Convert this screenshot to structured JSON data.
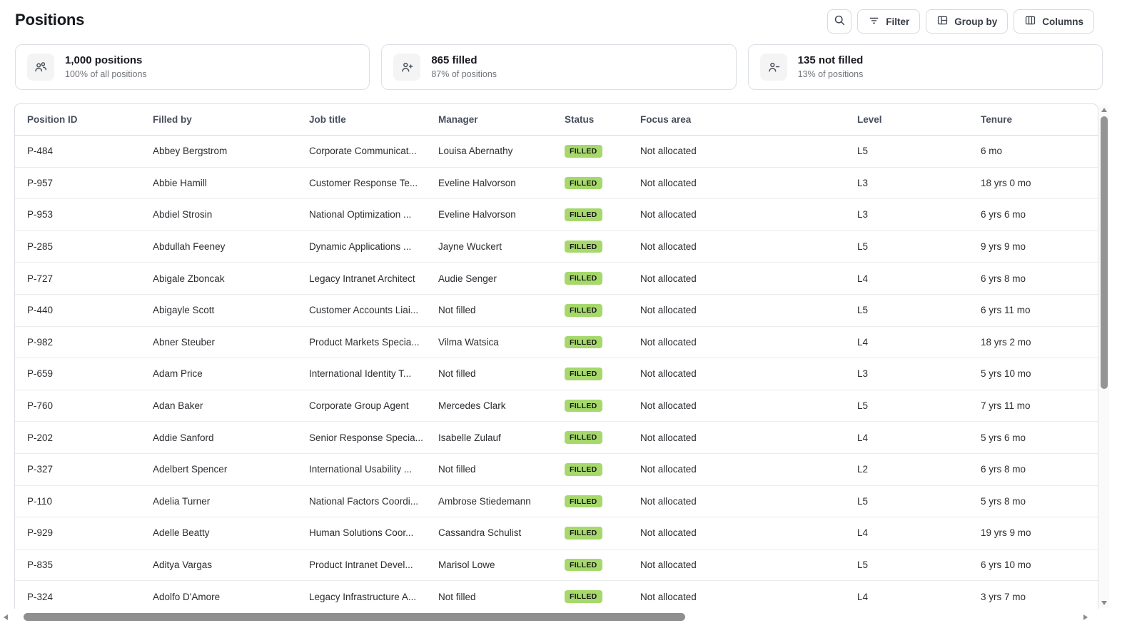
{
  "page": {
    "title": "Positions"
  },
  "toolbar": {
    "search_icon": "search-icon",
    "filter": {
      "label": "Filter",
      "icon": "filter-lines-icon"
    },
    "group_by": {
      "label": "Group by",
      "icon": "table-grid-icon"
    },
    "columns": {
      "label": "Columns",
      "icon": "columns-icon"
    }
  },
  "stats": [
    {
      "icon": "people-icon",
      "title": "1,000 positions",
      "subtitle": "100% of all positions"
    },
    {
      "icon": "person-plus-icon",
      "title": "865 filled",
      "subtitle": "87% of positions"
    },
    {
      "icon": "person-minus-icon",
      "title": "135 not filled",
      "subtitle": "13% of positions"
    }
  ],
  "table": {
    "columns": [
      "Position ID",
      "Filled by",
      "Job title",
      "Manager",
      "Status",
      "Focus area",
      "Level",
      "Tenure"
    ],
    "row_keys": [
      "position_id",
      "filled_by",
      "job_title",
      "manager",
      "status",
      "focus_area",
      "level",
      "tenure"
    ],
    "rows": [
      {
        "position_id": "P-484",
        "filled_by": "Abbey Bergstrom",
        "job_title": "Corporate Communicat...",
        "manager": "Louisa Abernathy",
        "status": "FILLED",
        "focus_area": "Not allocated",
        "level": "L5",
        "tenure": "6 mo"
      },
      {
        "position_id": "P-957",
        "filled_by": "Abbie Hamill",
        "job_title": "Customer Response Te...",
        "manager": "Eveline Halvorson",
        "status": "FILLED",
        "focus_area": "Not allocated",
        "level": "L3",
        "tenure": "18 yrs 0 mo"
      },
      {
        "position_id": "P-953",
        "filled_by": "Abdiel Strosin",
        "job_title": "National Optimization ...",
        "manager": "Eveline Halvorson",
        "status": "FILLED",
        "focus_area": "Not allocated",
        "level": "L3",
        "tenure": "6 yrs 6 mo"
      },
      {
        "position_id": "P-285",
        "filled_by": "Abdullah Feeney",
        "job_title": "Dynamic Applications ...",
        "manager": "Jayne Wuckert",
        "status": "FILLED",
        "focus_area": "Not allocated",
        "level": "L5",
        "tenure": "9 yrs 9 mo"
      },
      {
        "position_id": "P-727",
        "filled_by": "Abigale Zboncak",
        "job_title": "Legacy Intranet Architect",
        "manager": "Audie Senger",
        "status": "FILLED",
        "focus_area": "Not allocated",
        "level": "L4",
        "tenure": "6 yrs 8 mo"
      },
      {
        "position_id": "P-440",
        "filled_by": "Abigayle Scott",
        "job_title": "Customer Accounts Liai...",
        "manager": "Not filled",
        "status": "FILLED",
        "focus_area": "Not allocated",
        "level": "L5",
        "tenure": "6 yrs 11 mo"
      },
      {
        "position_id": "P-982",
        "filled_by": "Abner Steuber",
        "job_title": "Product Markets Specia...",
        "manager": "Vilma Watsica",
        "status": "FILLED",
        "focus_area": "Not allocated",
        "level": "L4",
        "tenure": "18 yrs 2 mo"
      },
      {
        "position_id": "P-659",
        "filled_by": "Adam Price",
        "job_title": "International Identity T...",
        "manager": "Not filled",
        "status": "FILLED",
        "focus_area": "Not allocated",
        "level": "L3",
        "tenure": "5 yrs 10 mo"
      },
      {
        "position_id": "P-760",
        "filled_by": "Adan Baker",
        "job_title": "Corporate Group Agent",
        "manager": "Mercedes Clark",
        "status": "FILLED",
        "focus_area": "Not allocated",
        "level": "L5",
        "tenure": "7 yrs 11 mo"
      },
      {
        "position_id": "P-202",
        "filled_by": "Addie Sanford",
        "job_title": "Senior Response Specia...",
        "manager": "Isabelle Zulauf",
        "status": "FILLED",
        "focus_area": "Not allocated",
        "level": "L4",
        "tenure": "5 yrs 6 mo"
      },
      {
        "position_id": "P-327",
        "filled_by": "Adelbert Spencer",
        "job_title": "International Usability ...",
        "manager": "Not filled",
        "status": "FILLED",
        "focus_area": "Not allocated",
        "level": "L2",
        "tenure": "6 yrs 8 mo"
      },
      {
        "position_id": "P-110",
        "filled_by": "Adelia Turner",
        "job_title": "National Factors Coordi...",
        "manager": "Ambrose Stiedemann",
        "status": "FILLED",
        "focus_area": "Not allocated",
        "level": "L5",
        "tenure": "5 yrs 8 mo"
      },
      {
        "position_id": "P-929",
        "filled_by": "Adelle Beatty",
        "job_title": "Human Solutions Coor...",
        "manager": "Cassandra Schulist",
        "status": "FILLED",
        "focus_area": "Not allocated",
        "level": "L4",
        "tenure": "19 yrs 9 mo"
      },
      {
        "position_id": "P-835",
        "filled_by": "Aditya Vargas",
        "job_title": "Product Intranet Devel...",
        "manager": "Marisol Lowe",
        "status": "FILLED",
        "focus_area": "Not allocated",
        "level": "L5",
        "tenure": "6 yrs 10 mo"
      },
      {
        "position_id": "P-324",
        "filled_by": "Adolfo D'Amore",
        "job_title": "Legacy Infrastructure A...",
        "manager": "Not filled",
        "status": "FILLED",
        "focus_area": "Not allocated",
        "level": "L4",
        "tenure": "3 yrs 7 mo"
      }
    ]
  },
  "colors": {
    "badge_filled_bg": "#a6d86c",
    "badge_filled_text": "#14170f",
    "border": "#d9dce1",
    "subtext": "#70747c"
  }
}
